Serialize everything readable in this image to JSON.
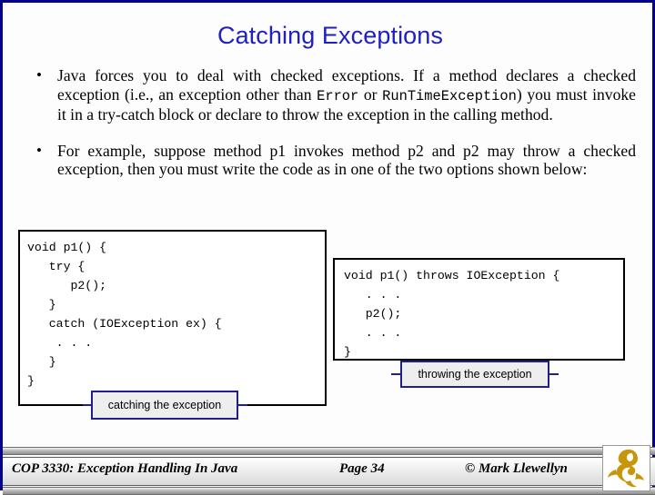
{
  "slide": {
    "title": "Catching Exceptions",
    "border_color": "#00008b",
    "title_color": "#2020c0",
    "background": "#fdfdfd"
  },
  "bullets": [
    {
      "marker": "•",
      "segments": [
        {
          "type": "text",
          "value": "Java forces you to deal with checked exceptions.  If a method declares a  checked  exception  (i.e.,  an  exception  other  than  "
        },
        {
          "type": "code",
          "value": "Error"
        },
        {
          "type": "text",
          "value": "  or  "
        },
        {
          "type": "code",
          "value": "RunTimeException"
        },
        {
          "type": "text",
          "value": ") you must invoke it in a try-catch block or declare to throw the exception in the calling method."
        }
      ],
      "plain": "Java forces you to deal with checked exceptions.  If a method declares a checked exception (i.e., an exception other than Error or RunTimeException) you must invoke it in a try-catch block or declare to throw the exception in the calling method."
    },
    {
      "marker": "•",
      "segments": [
        {
          "type": "text",
          "value": "For example, suppose method p1 invokes method p2 and p2 may throw a checked exception, then you must write the code as in one of the two options shown below:"
        }
      ],
      "plain": "For example, suppose method p1 invokes method p2 and p2 may throw a checked exception, then you must write the code as in one of the two options shown below:"
    }
  ],
  "code_boxes": [
    {
      "id": "catching",
      "code": "void p1() {\n   try {\n      p2();\n   }\n   catch (IOException ex) {\n    . . .\n   }\n}"
    },
    {
      "id": "throwing",
      "code": "void p1() throws IOException {\n   . . .\n   p2();\n   . . .\n}"
    }
  ],
  "callouts": [
    {
      "id": "catching",
      "label": "catching the exception"
    },
    {
      "id": "throwing",
      "label": "throwing the exception"
    }
  ],
  "footer": {
    "course": "COP 3330:  Exception Handling In Java",
    "page": "Page 34",
    "author": "© Mark Llewellyn",
    "logo_name": "ucf-pegasus-logo",
    "logo_color": "#c8960c"
  }
}
